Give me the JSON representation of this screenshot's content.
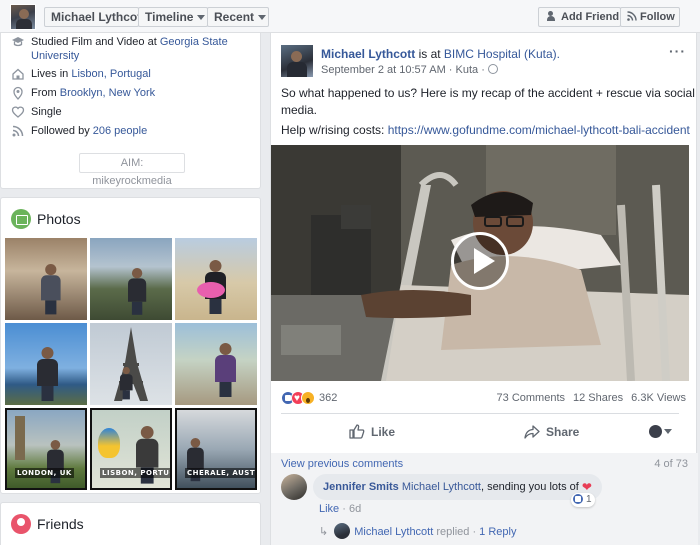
{
  "topbar": {
    "name": "Michael Lythcott",
    "timeline": "Timeline",
    "recent": "Recent",
    "add_friend": "Add Friend",
    "follow": "Follow"
  },
  "intro": {
    "studied_prefix": "Studied Film and Video at ",
    "studied_school_1": "Georgia State",
    "studied_school_2": "University",
    "lives_prefix": "Lives in ",
    "lives_place": "Lisbon, Portugal",
    "from_prefix": "From ",
    "from_place": "Brooklyn, New York",
    "relationship": "Single",
    "followed_prefix": "Followed by ",
    "followed_count": "206 people",
    "aim": "AIM: mikeyrockmedia"
  },
  "photos": {
    "title": "Photos",
    "captions": [
      "LONDON, UK",
      "LISBON, PORTUGAL",
      "CHERALE, AUSTRALIA"
    ]
  },
  "friends": {
    "title": "Friends"
  },
  "post": {
    "author": "Michael Lythcott",
    "is_at": " is at ",
    "place": "BIMC Hospital (Kuta).",
    "date": "September 2 at 10:57 AM",
    "location": " · Kuta ·",
    "more": "···",
    "text_line1": "So what happened to us? Here is my recap of the accident + rescue via social",
    "text_line2": "media.",
    "help_prefix": "Help w/rising costs: ",
    "help_link": "https://www.gofundme.com/michael-lythcott-bali-accident",
    "reaction_count": "362",
    "comments_count": "73 Comments",
    "shares_count": "12 Shares",
    "views_count": "6.3K Views",
    "like_label": "Like",
    "share_label": "Share"
  },
  "comments": {
    "view_previous": "View previous comments",
    "position": "4 of 73",
    "commenter": "Jennifer Smits",
    "mention": "Michael Lythcott",
    "text": ", sending you lots of",
    "reaction_count": "1",
    "like_label": "Like",
    "age": " · 6d",
    "reply_author": "Michael Lythcott",
    "reply_text": " replied ",
    "reply_link": "1 Reply"
  },
  "colors": {
    "link": "#365899",
    "brand": "#4267b2",
    "background": "#e9ebee"
  }
}
